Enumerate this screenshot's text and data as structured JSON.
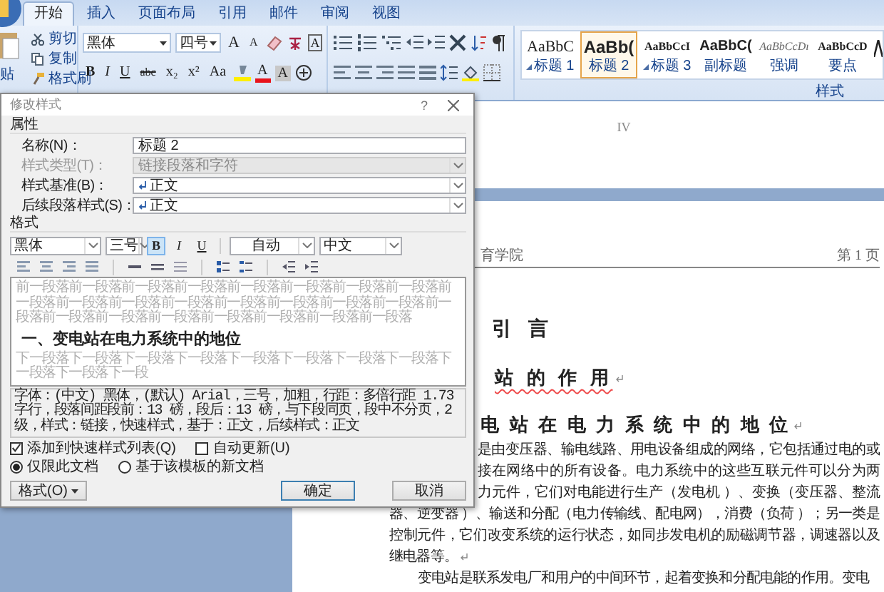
{
  "ribbon": {
    "tabs": [
      {
        "label": "开始",
        "selected": true
      },
      {
        "label": "插入",
        "selected": false
      },
      {
        "label": "页面布局",
        "selected": false
      },
      {
        "label": "引用",
        "selected": false
      },
      {
        "label": "邮件",
        "selected": false
      },
      {
        "label": "审阅",
        "selected": false
      },
      {
        "label": "视图",
        "selected": false
      }
    ],
    "paste": "贴",
    "clipboard": [
      "剪切",
      "复制",
      "格式刷"
    ],
    "font": "黑体",
    "size": "四号",
    "font_row1": [
      "A",
      "A",
      "A"
    ],
    "font_row2": [
      "B",
      "I",
      "U",
      "abc",
      "x₂",
      "x²",
      "Aa",
      "A",
      "A"
    ],
    "styles": [
      {
        "sample": "AaBbC",
        "label": "标题 1",
        "kind": "heading1",
        "linked": true,
        "selected": false
      },
      {
        "sample": "AaBb(",
        "label": "标题 2",
        "kind": "heading2",
        "linked": false,
        "selected": true
      },
      {
        "sample": "AaBbCcI",
        "label": "标题 3",
        "kind": "heading3",
        "linked": true,
        "selected": false
      },
      {
        "sample": "AaBbC(",
        "label": "副标题",
        "kind": "subtitle",
        "linked": false,
        "selected": false
      },
      {
        "sample": "AaBbCcDı",
        "label": "强调",
        "kind": "emphasis",
        "linked": false,
        "selected": false
      },
      {
        "sample": "AaBbCcD",
        "label": "要点",
        "kind": "strong",
        "linked": false,
        "selected": false
      }
    ],
    "styles_group": "样式"
  },
  "document": {
    "prev_footer": "IV",
    "header_left": "育学院",
    "header_right": "第 1 页",
    "title": "引 言",
    "lines": [
      {
        "kind": "subheading",
        "text": "站 的 作 用",
        "mark": true
      },
      {
        "kind": "section",
        "text": "电 站 在 电 力 系 统 中 的 地 位",
        "mark": true
      },
      {
        "kind": "cut",
        "text": "是由变压器、输电线路、用电设备组成的网络，它包括通过电的或",
        "mark": false
      },
      {
        "kind": "cut",
        "text": "接在网络中的所有设备。电力系统中的这些互联元件可以分为两",
        "mark": false
      },
      {
        "kind": "cut",
        "text": "力元件，它们对电能进行生产（发电机 ）、变换（变压器、整流",
        "mark": false
      },
      {
        "kind": "full",
        "text": "器、逆变器 ）、输送和分配（电力传输线、配电网），消费（负荷 ）；另一类是",
        "mark": false
      },
      {
        "kind": "full",
        "text": "控制元件，它们改变系统的运行状态，如同步发电机的励磁调节器，调速器以及",
        "mark": false
      },
      {
        "kind": "last",
        "text": "继电器等。",
        "mark": true
      },
      {
        "kind": "indent",
        "text": "变电站是联系发电厂和用户的中间环节，起着变换和分配电能的作用。变电",
        "mark": false
      }
    ]
  },
  "dialog": {
    "title": "修改样式",
    "help": "?",
    "properties_heading": "属性",
    "rows": [
      {
        "label": "名称(N)：",
        "value": "标题 2",
        "kind": "text",
        "disabled": false,
        "para_mark": false
      },
      {
        "label": "样式类型(T)：",
        "value": "链接段落和字符",
        "kind": "select",
        "disabled": true,
        "para_mark": false
      },
      {
        "label": "样式基准(B)：",
        "value": "正文",
        "kind": "select",
        "disabled": false,
        "para_mark": true
      },
      {
        "label": "后续段落样式(S)：",
        "value": "正文",
        "kind": "select",
        "disabled": false,
        "para_mark": true
      }
    ],
    "format_heading": "格式",
    "font": "黑体",
    "size": "三号",
    "styles": [
      {
        "label": "B",
        "selected": true
      },
      {
        "label": "I",
        "selected": false
      },
      {
        "label": "U",
        "selected": false
      }
    ],
    "font_color": "自动",
    "language": "中文",
    "preview": {
      "before": "前一段落前一段落前一段落前一段落前一段落前一段落前一段落前一段落前一段落前一段落前一段落前一段落前一段落前一段落前一段落前一段落前一段落前一段落前一段落前一段落前一段落前一段落前一段落前一段落",
      "heading": "一、变电站在电力系统中的地位",
      "after": "下一段落下一段落下一段落下一段落下一段落下一段落下一段落下一段落下一段落下一段落下一段"
    },
    "description": "字体：(中文) 黑体，(默认) Arial，三号，加粗，行距：多倍行距 1.73 字行，段落间距段前：13 磅，段后：13 磅，与下段同页，段中不分页，2 级，样式：链接，快速样式，基于：正文，后续样式：正文",
    "options": [
      {
        "label": "添加到快速样式列表(Q)",
        "checked": true
      },
      {
        "label": "自动更新(U)",
        "checked": false
      }
    ],
    "scope": [
      {
        "label": "仅限此文档",
        "selected": true
      },
      {
        "label": "基于该模板的新文档",
        "selected": false
      }
    ],
    "format_button": "格式(O)",
    "ok": "确定",
    "cancel": "取消"
  }
}
